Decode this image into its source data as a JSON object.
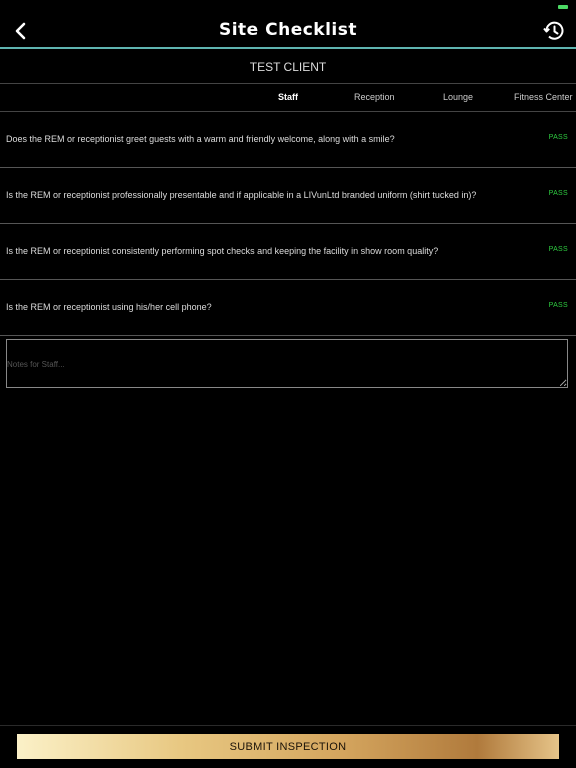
{
  "header": {
    "title": "Site Checklist"
  },
  "client": {
    "name": "TEST CLIENT"
  },
  "tabs": [
    {
      "label": "Staff",
      "active": true
    },
    {
      "label": "Reception",
      "active": false
    },
    {
      "label": "Lounge",
      "active": false
    },
    {
      "label": "Fitness Center",
      "active": false
    }
  ],
  "questions": [
    {
      "text": "Does the REM or receptionist greet guests with a warm and friendly welcome, along with a smile?",
      "status": "PASS"
    },
    {
      "text": "Is the REM or receptionist professionally presentable and if applicable in a LIVunLtd branded uniform (shirt tucked in)?",
      "status": "PASS"
    },
    {
      "text": "Is the REM or receptionist consistently performing spot checks and keeping the facility in show room quality?",
      "status": "PASS"
    },
    {
      "text": "Is the REM or receptionist using his/her cell phone?",
      "status": "PASS"
    }
  ],
  "notes": {
    "placeholder": "Notes for Staff..."
  },
  "submit": {
    "label": "SUBMIT INSPECTION"
  },
  "icons": {
    "back": "chevron-left-icon",
    "history": "history-icon"
  },
  "colors": {
    "accent_line": "#5fb4b0",
    "pass": "#2ecc40",
    "background": "#000000"
  }
}
